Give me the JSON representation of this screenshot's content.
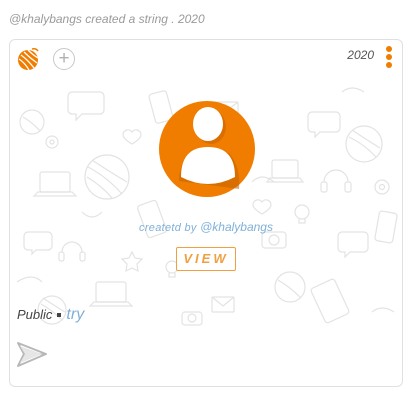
{
  "headline": "@khalybangs created a string . 2020",
  "card": {
    "year": "2020",
    "created_by_prefix": "createtd by",
    "created_by_user": "@khalybangs",
    "view_label": "VIEW",
    "visibility": "Public",
    "tag": "try",
    "add_label": "+"
  },
  "colors": {
    "accent": "#f07d00",
    "link": "#7fb0d8"
  },
  "icons": [
    "yarn-ball-icon",
    "add-icon",
    "kebab-menu-icon",
    "user-avatar-icon",
    "send-icon"
  ]
}
